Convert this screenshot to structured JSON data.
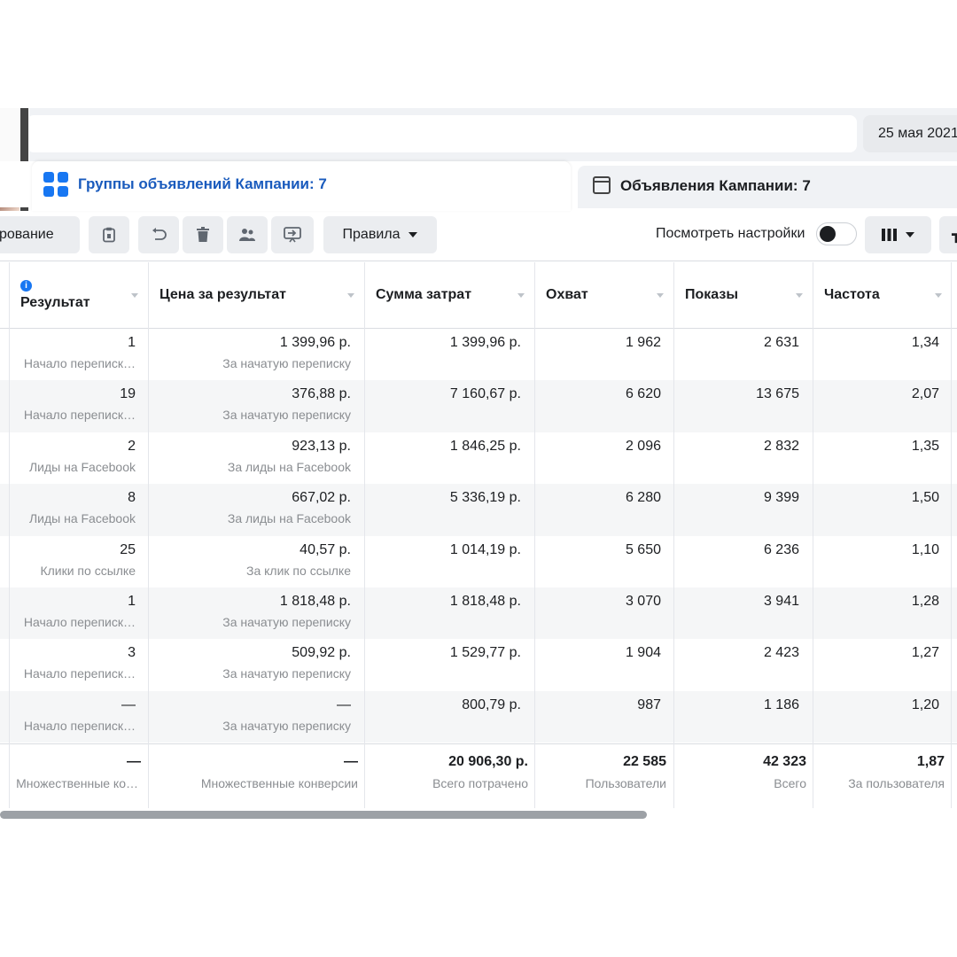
{
  "header": {
    "date_label": "25 мая 2021"
  },
  "tabs": [
    {
      "label": "Группы объявлений Кампании: 7",
      "active": true,
      "icon": "ad-groups-grid-icon"
    },
    {
      "label": "Объявления Кампании: 7",
      "active": false,
      "icon": "ads-window-icon"
    }
  ],
  "toolbar": {
    "duplicate_label": "ирование",
    "rules_label": "Правила",
    "view_settings_label": "Посмотреть настройки",
    "icons": [
      "clipboard-icon",
      "undo-icon",
      "trash-icon",
      "people-icon",
      "export-icon",
      "columns-icon"
    ]
  },
  "table": {
    "columns": [
      "Результат",
      "Цена за результат",
      "Сумма затрат",
      "Охват",
      "Показы",
      "Частота"
    ],
    "rows": [
      {
        "result": "1",
        "result_type": "Начало переписк…",
        "cost": "1 399,96 р.",
        "cost_type": "За начатую переписку",
        "spend": "1 399,96 р.",
        "reach": "1 962",
        "impressions": "2 631",
        "frequency": "1,34"
      },
      {
        "result": "19",
        "result_type": "Начало переписк…",
        "cost": "376,88 р.",
        "cost_type": "За начатую переписку",
        "spend": "7 160,67 р.",
        "reach": "6 620",
        "impressions": "13 675",
        "frequency": "2,07"
      },
      {
        "result": "2",
        "result_type": "Лиды на Facebook",
        "cost": "923,13 р.",
        "cost_type": "За лиды на Facebook",
        "spend": "1 846,25 р.",
        "reach": "2 096",
        "impressions": "2 832",
        "frequency": "1,35"
      },
      {
        "result": "8",
        "result_type": "Лиды на Facebook",
        "cost": "667,02 р.",
        "cost_type": "За лиды на Facebook",
        "spend": "5 336,19 р.",
        "reach": "6 280",
        "impressions": "9 399",
        "frequency": "1,50"
      },
      {
        "result": "25",
        "result_type": "Клики по ссылке",
        "cost": "40,57 р.",
        "cost_type": "За клик по ссылке",
        "spend": "1 014,19 р.",
        "reach": "5 650",
        "impressions": "6 236",
        "frequency": "1,10"
      },
      {
        "result": "1",
        "result_type": "Начало переписк…",
        "cost": "1 818,48 р.",
        "cost_type": "За начатую переписку",
        "spend": "1 818,48 р.",
        "reach": "3 070",
        "impressions": "3 941",
        "frequency": "1,28"
      },
      {
        "result": "3",
        "result_type": "Начало переписк…",
        "cost": "509,92 р.",
        "cost_type": "За начатую переписку",
        "spend": "1 529,77 р.",
        "reach": "1 904",
        "impressions": "2 423",
        "frequency": "1,27"
      },
      {
        "result": "—",
        "result_type": "Начало переписк…",
        "cost": "—",
        "cost_type": "За начатую переписку",
        "spend": "800,79 р.",
        "reach": "987",
        "impressions": "1 186",
        "frequency": "1,20"
      }
    ],
    "totals": {
      "result": "—",
      "result_sub": "Множественные ко…",
      "cost": "—",
      "cost_sub": "Множественные конверсии",
      "spend": "20 906,30 р.",
      "spend_sub": "Всего потрачено",
      "reach": "22 585",
      "reach_sub": "Пользователи",
      "impressions": "42 323",
      "impressions_sub": "Всего",
      "frequency": "1,87",
      "frequency_sub": "За пользователя"
    }
  }
}
